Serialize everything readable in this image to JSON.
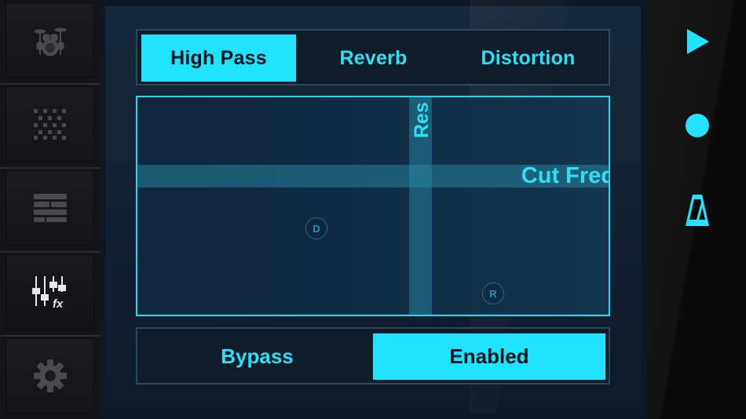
{
  "sidebar": {
    "items": [
      {
        "icon": "drum-kit-icon"
      },
      {
        "icon": "pattern-grid-icon"
      },
      {
        "icon": "song-arranger-icon"
      },
      {
        "icon": "mixer-fx-icon",
        "badge": "fx",
        "active": true
      },
      {
        "icon": "gear-icon"
      }
    ]
  },
  "effects": {
    "tabs": [
      {
        "label": "High Pass",
        "active": true
      },
      {
        "label": "Reverb",
        "active": false
      },
      {
        "label": "Distortion",
        "active": false
      }
    ]
  },
  "pad": {
    "y_axis_label": "Res",
    "x_axis_label": "Cut Freq",
    "knobs": [
      {
        "label": "D"
      },
      {
        "label": "R"
      }
    ]
  },
  "toggle": {
    "bypass_label": "Bypass",
    "enabled_label": "Enabled",
    "selected": "Enabled"
  },
  "transport": {
    "items": [
      {
        "icon": "play-icon"
      },
      {
        "icon": "record-icon"
      },
      {
        "icon": "metronome-icon"
      }
    ]
  },
  "colors": {
    "accent": "#1fe3ff",
    "accent_text": "#2ee0f5",
    "active_text": "#04141f",
    "panel_bg": "#142538"
  }
}
